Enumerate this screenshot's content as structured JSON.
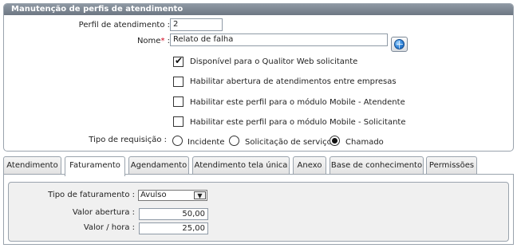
{
  "panel": {
    "title": "Manutenção de perfis de atendimento",
    "perfil_label": "Perfil de atendimento :",
    "perfil_value": "2",
    "nome_label": "Nome",
    "nome_required": "*",
    "nome_colon": ":",
    "nome_value": "Relato de falha",
    "lookup_icon": "globe-icon",
    "checkboxes": [
      {
        "label": "Disponível para o Qualitor Web solicitante",
        "checked": true
      },
      {
        "label": "Habilitar abertura de atendimentos entre empresas",
        "checked": false
      },
      {
        "label": "Habilitar este perfil para o módulo Mobile - Atendente",
        "checked": false
      },
      {
        "label": "Habilitar este perfil para o módulo Mobile - Solicitante",
        "checked": false
      }
    ],
    "tipo_label": "Tipo de requisição :",
    "radios": [
      {
        "label": "Incidente",
        "checked": false
      },
      {
        "label": "Solicitação de serviço",
        "checked": false
      },
      {
        "label": "Chamado",
        "checked": true
      }
    ]
  },
  "tabs": [
    "Atendimento",
    "Faturamento",
    "Agendamento",
    "Atendimento tela única",
    "Anexo",
    "Base de conhecimento",
    "Permissões"
  ],
  "active_tab": "Faturamento",
  "faturamento": {
    "tipo_label": "Tipo de faturamento :",
    "tipo_value": "Avulso",
    "valor_abertura_label": "Valor abertura :",
    "valor_abertura_value": "50,00",
    "valor_hora_label": "Valor / hora :",
    "valor_hora_value": "25,00"
  }
}
